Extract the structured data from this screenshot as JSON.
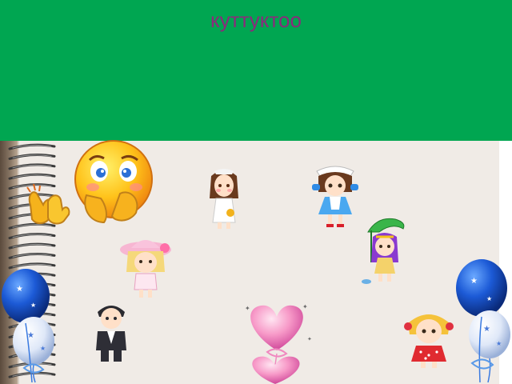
{
  "title": "куттуктоо",
  "colors": {
    "header_bg": "#00a651",
    "title_text": "#8b2a7c",
    "paper_bg": "#f0ebe6"
  },
  "icons": [
    "clapping-hands-icon",
    "blushing-smiley-icon",
    "bride-girl-icon",
    "maid-girl-icon",
    "pink-hat-girl-icon",
    "leaf-umbrella-girl-icon",
    "suit-boy-icon",
    "red-dress-girl-icon",
    "blue-balloons-icon",
    "pink-heart-balloons-icon"
  ]
}
